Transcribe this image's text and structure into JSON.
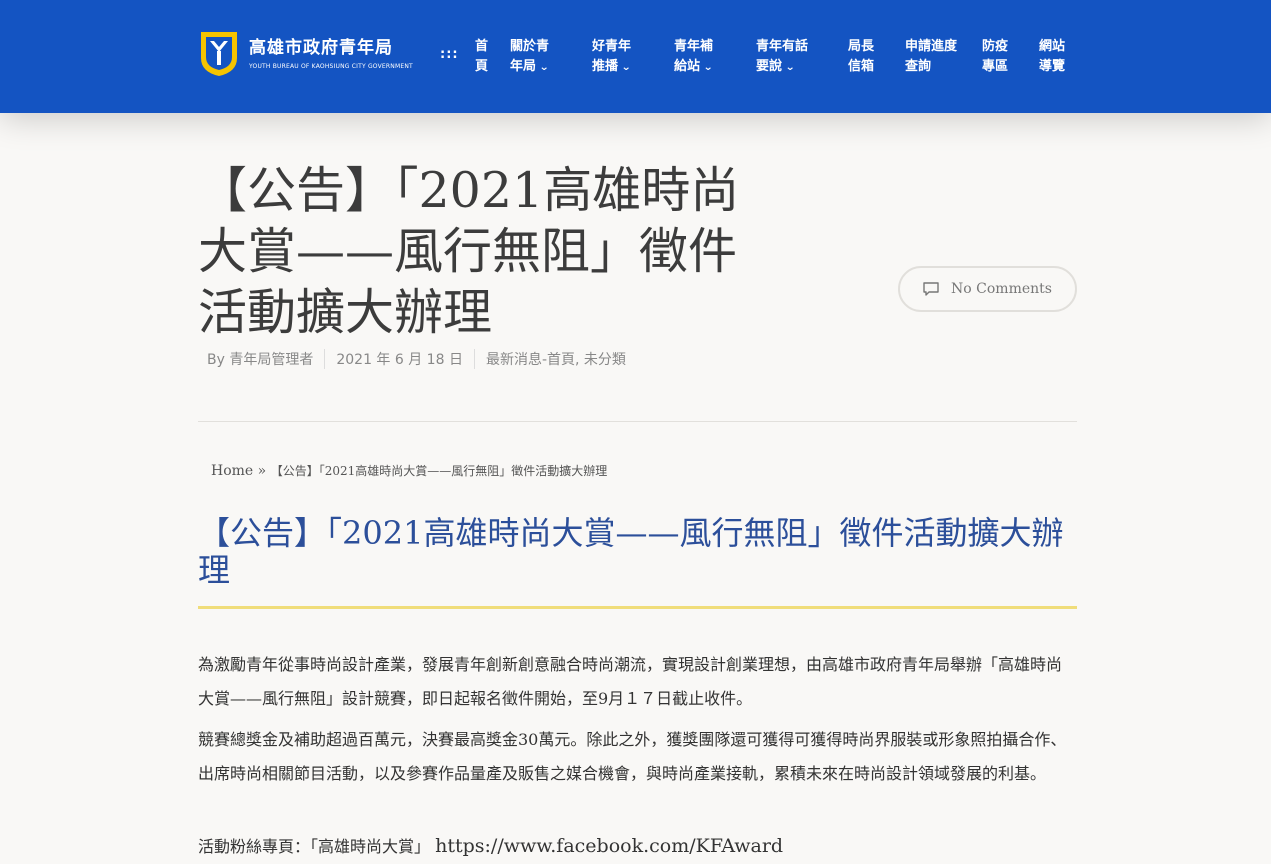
{
  "header": {
    "logo_cn": "高雄市政府青年局",
    "logo_en": "YOUTH BUREAU OF KAOHSIUNG CITY GOVERNMENT",
    "menu_dots": ":::",
    "brand_color": "#1454c2",
    "nav": [
      {
        "line1": "首",
        "line2": "頁",
        "dropdown": false
      },
      {
        "line1": "關於青",
        "line2": "年局",
        "dropdown": true
      },
      {
        "line1": "好青年",
        "line2": "推播",
        "dropdown": true
      },
      {
        "line1": "青年補",
        "line2": "給站",
        "dropdown": true
      },
      {
        "line1": "青年有話",
        "line2": "要說",
        "dropdown": true
      },
      {
        "line1": "局長",
        "line2": "信箱",
        "dropdown": false
      },
      {
        "line1": "申請進度",
        "line2": "查詢",
        "dropdown": false
      },
      {
        "line1": "防疫",
        "line2": "專區",
        "dropdown": false
      },
      {
        "line1": "網站",
        "line2": "導覽",
        "dropdown": false
      }
    ]
  },
  "post": {
    "title_lines": [
      "【公告】「2021高雄時尚",
      "大賞——風行無阻」徵件",
      "活動擴大辦理"
    ],
    "comments_label": "No Comments",
    "meta": {
      "author": "By 青年局管理者",
      "date": "2021 年 6 月 18 日",
      "categories": "最新消息-首頁, 未分類"
    }
  },
  "breadcrumb": {
    "home": "Home",
    "separator": "»",
    "current": "【公告】「2021高雄時尚大賞——風行無阻」徵件活動擴大辦理"
  },
  "article": {
    "title": "【公告】「2021高雄時尚大賞——風行無阻」徵件活動擴大辦理",
    "title_color": "#2c4f9a",
    "underline_color": "#f0dd7a",
    "p1": "為激勵青年從事時尚設計產業，發展青年創新創意融合時尚潮流，實現設計創業理想，由高雄市政府青年局舉辦「高雄時尚大賞——風行無阻」設計競賽，即日起報名徵件開始，至9月１７日截止收件。",
    "p2": "競賽總獎金及補助超過百萬元，決賽最高獎金30萬元。除此之外，獲獎團隊還可獲得可獲得時尚界服裝或形象照拍攝合作、出席時尚相關節目活動，以及參賽作品量產及販售之媒合機會，與時尚產業接軌，累積未來在時尚設計領域發展的利基。",
    "fan_label": "活動粉絲專頁：「高雄時尚大賞」",
    "fan_link": "https://www.facebook.com/KFAward"
  }
}
